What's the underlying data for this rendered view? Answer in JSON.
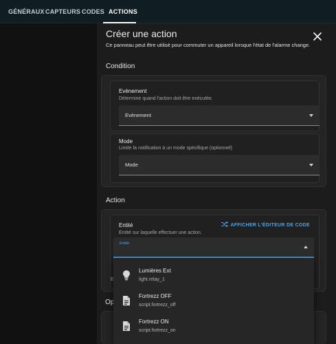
{
  "tabs": [
    {
      "label": "GÉNÉRAUX"
    },
    {
      "label": "CAPTEURS"
    },
    {
      "label": "CODES"
    },
    {
      "label": "ACTIONS"
    }
  ],
  "dialog": {
    "title": "Créer une action",
    "description": "Ce panneau peut être utilisé pour commuter un appareil lorsque l'état de l'alarme change."
  },
  "condition": {
    "section_title": "Condition",
    "event": {
      "label": "Evènement",
      "hint": "Détermine quand l'action doit être exécutée.",
      "value": "Evènement"
    },
    "mode": {
      "label": "Mode",
      "hint": "Limite la notification à un mode spécifique (optionnel)",
      "value": "Mode"
    }
  },
  "action": {
    "section_title": "Action",
    "entity": {
      "label": "Entité",
      "hint": "Entité sur laquelle effectuer une action.",
      "code_editor_label": "AFFICHER L'ÉDITEUR DE CODE",
      "input_label": "Entité"
    },
    "dropdown": [
      {
        "title": "Lumières Ext",
        "subtitle": "light.relay_1",
        "icon": "lightbulb-icon"
      },
      {
        "title": "Fortrezz OFF",
        "subtitle": "script.fortrezz_off",
        "icon": "script-file-icon"
      },
      {
        "title": "Fortrezz ON",
        "subtitle": "script.fortrezz_on",
        "icon": "script-file-icon"
      }
    ]
  },
  "obscured": {
    "left_fragment": "E",
    "options_fragment": "Op"
  },
  "colors": {
    "accent": "#3c95e0",
    "background": "#111111",
    "dialog": "#1c1c1c"
  }
}
